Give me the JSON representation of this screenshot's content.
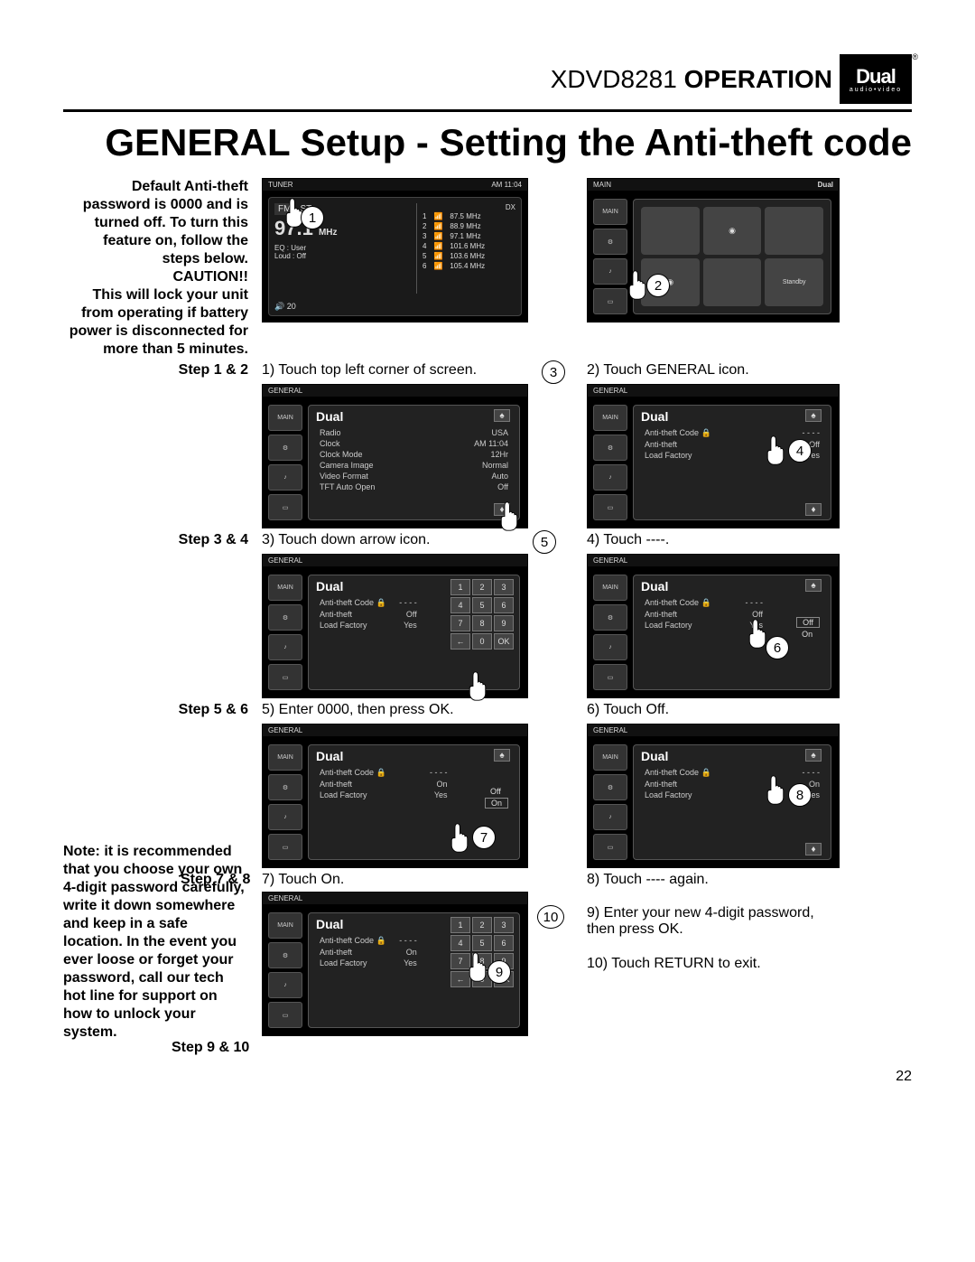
{
  "header": {
    "model": "XDVD8281",
    "section": "OPERATION"
  },
  "brand": {
    "name": "Dual",
    "sub": "audio•video"
  },
  "title": "GENERAL Setup - Setting the Anti-theft code",
  "intro": "Default Anti-theft password is 0000 and is turned off. To turn this feature on, follow the steps below.",
  "caution_label": "CAUTION!!",
  "caution_text": "This will lock your unit from operating if battery power is disconnected for more than 5 minutes.",
  "steps": {
    "s12": {
      "label": "Step 1 & 2",
      "c1": "1) Touch top left corner of screen.",
      "c2": "2) Touch GENERAL icon."
    },
    "s34": {
      "label": "Step 3 & 4",
      "c1": "3) Touch down arrow icon.",
      "c2": "4) Touch ----."
    },
    "s56": {
      "label": "Step 5 & 6",
      "c1": "5) Enter 0000, then press OK.",
      "c2": "6) Touch Off."
    },
    "s78": {
      "label": "Step 7 & 8",
      "c1": "7) Touch On.",
      "c2": "8) Touch ---- again."
    },
    "s910": {
      "label": "Step 9 & 10",
      "c1": "9) Enter your new 4-digit password, then press OK.",
      "c2": "10) Touch RETURN to exit."
    }
  },
  "note": "Note: it is recommended that you choose your own 4-digit password carefully, write it down somewhere and keep in a safe location. In the event you ever loose or forget your password, call our tech hot line for support on how to unlock your system.",
  "page_number": "22",
  "callouts": {
    "n1": "1",
    "n2": "2",
    "n3": "3",
    "n4": "4",
    "n5": "5",
    "n6": "6",
    "n7": "7",
    "n8": "8",
    "n9": "9",
    "n10": "10"
  },
  "screen1": {
    "topleft": "TUNER",
    "time": "AM 11:04",
    "fm": "FM",
    "st": "ST",
    "freq": "97.1",
    "mhz": "MHz",
    "dx": "DX",
    "eq": "EQ   : User",
    "loud": "Loud : Off",
    "presets": [
      {
        "n": "1",
        "v": "87.5 MHz"
      },
      {
        "n": "2",
        "v": "88.9 MHz"
      },
      {
        "n": "3",
        "v": "97.1 MHz"
      },
      {
        "n": "4",
        "v": "101.6 MHz"
      },
      {
        "n": "5",
        "v": "103.6 MHz"
      },
      {
        "n": "6",
        "v": "105.4 MHz"
      }
    ],
    "vol": "20"
  },
  "screen2": {
    "main": "MAIN",
    "standby": "Standby"
  },
  "screen3": {
    "topleft": "GENERAL",
    "rows": [
      {
        "k": "Radio",
        "v": "USA"
      },
      {
        "k": "Clock",
        "v": "AM 11:04"
      },
      {
        "k": "Clock Mode",
        "v": "12Hr"
      },
      {
        "k": "Camera Image",
        "v": "Normal"
      },
      {
        "k": "Video Format",
        "v": "Auto"
      },
      {
        "k": "TFT Auto Open",
        "v": "Off"
      }
    ]
  },
  "screen4_general": {
    "topleft": "GENERAL",
    "rows": [
      {
        "k": "Anti-theft Code",
        "v": "- - - -",
        "lock": true
      },
      {
        "k": "Anti-theft",
        "v": "Off"
      },
      {
        "k": "Load Factory",
        "v": "Yes"
      }
    ]
  },
  "screen6_options": {
    "on": "On",
    "off": "Off"
  },
  "screen7": {
    "rows": [
      {
        "k": "Anti-theft Code",
        "v": "- - - -",
        "lock": true
      },
      {
        "k": "Anti-theft",
        "v": "On"
      },
      {
        "k": "Load Factory",
        "v": "Yes"
      }
    ],
    "opt_on": "On",
    "opt_off": "Off"
  },
  "keypad": [
    "1",
    "2",
    "3",
    "4",
    "5",
    "6",
    "7",
    "8",
    "9",
    "←",
    "0",
    "OK"
  ],
  "main_label": "MAIN",
  "dual_label": "Dual",
  "lock_icon": "🔒",
  "up_arrow": "♠",
  "down_arrow": "♦",
  "vol_icon": "🔊"
}
